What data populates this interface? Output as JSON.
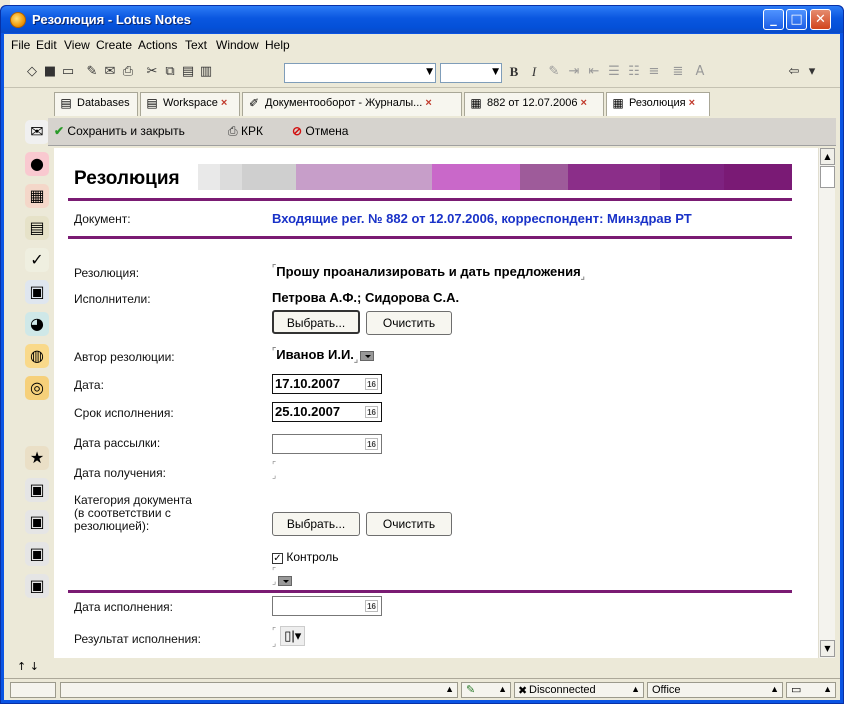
{
  "window": {
    "title": "Резолюция - Lotus Notes"
  },
  "menu": [
    "File",
    "Edit",
    "View",
    "Create",
    "Actions",
    "Text",
    "Window",
    "Help"
  ],
  "toolbar": {
    "bold": "B",
    "italic": "I"
  },
  "tabs": [
    {
      "label": "Databases",
      "icon": "database-icon",
      "close": false
    },
    {
      "label": "Workspace",
      "icon": "workspace-icon",
      "close": true
    },
    {
      "label": "Документооборот - Журналы...",
      "icon": "journal-icon",
      "close": true
    },
    {
      "label": "882 от 12.07.2006",
      "icon": "document-icon",
      "close": true
    },
    {
      "label": "Резолюция",
      "icon": "document-icon",
      "close": true
    }
  ],
  "actions": {
    "save_close": "Сохранить и закрыть",
    "print": "КРК",
    "cancel": "Отмена"
  },
  "form": {
    "title": "Резолюция",
    "colors": [
      "#ffffff",
      "#e9e9e9",
      "#dcdcdc",
      "#cfcfcf",
      "#c79ec9",
      "#c98fcc",
      "#c050bf",
      "#9e5b9a",
      "#8b2e89",
      "#7a1f78",
      "#7a1a75"
    ],
    "doc_label": "Документ:",
    "doc_value": "Входящие рег. № 882 от 12.07.2006, корреспондент:  Минздрав РТ",
    "resolution_label": "Резолюция:",
    "resolution_value": "Прошу проанализировать и дать предложения",
    "executors_label": "Исполнители:",
    "executors_value": "Петрова А.Ф.; Сидорова С.А.",
    "choose": "Выбрать...",
    "clear": "Очистить",
    "author_label": "Автор резолюции:",
    "author_value": "Иванов И.И.",
    "date_label": "Дата:",
    "date_value": "17.10.2007",
    "deadline_label": "Срок исполнения:",
    "deadline_value": "25.10.2007",
    "mailing_label": "Дата рассылки:",
    "mailing_value": "",
    "received_label": "Дата получения:",
    "category_label_1": "Категория документа",
    "category_label_2": "(в соответствии с",
    "category_label_3": "резолюцией):",
    "control_label": "Контроль",
    "control_checked": true,
    "exec_date_label": "Дата исполнения:",
    "exec_result_label": "Результат исполнения:",
    "cal_icon": "16"
  },
  "status": {
    "connection": "Disconnected",
    "location": "Office"
  }
}
